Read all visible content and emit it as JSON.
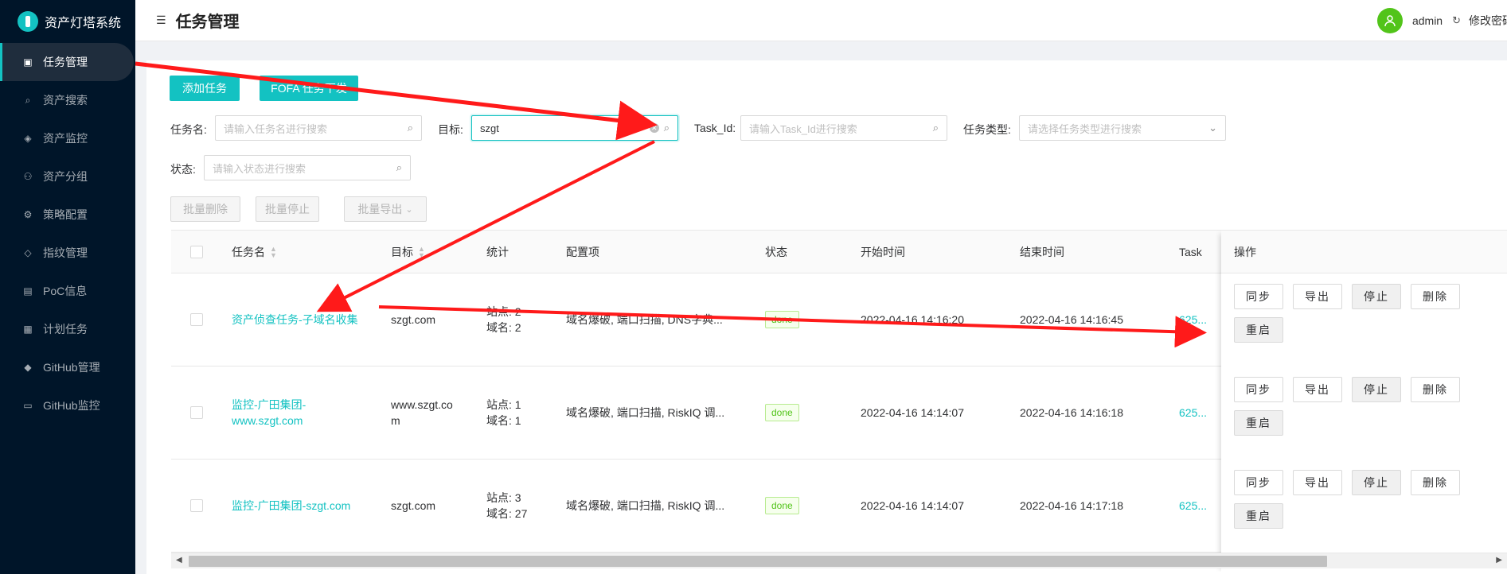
{
  "sidebar": {
    "app_title": "资产灯塔系统",
    "items": [
      {
        "label": "任务管理",
        "icon": "task-icon",
        "active": true
      },
      {
        "label": "资产搜索",
        "icon": "search-icon",
        "active": false
      },
      {
        "label": "资产监控",
        "icon": "shield-icon",
        "active": false
      },
      {
        "label": "资产分组",
        "icon": "group-icon",
        "active": false
      },
      {
        "label": "策略配置",
        "icon": "gear-icon",
        "active": false
      },
      {
        "label": "指纹管理",
        "icon": "tag-icon",
        "active": false
      },
      {
        "label": "PoC信息",
        "icon": "document-icon",
        "active": false
      },
      {
        "label": "计划任务",
        "icon": "schedule-icon",
        "active": false
      },
      {
        "label": "GitHub管理",
        "icon": "github-icon",
        "active": false
      },
      {
        "label": "GitHub监控",
        "icon": "monitor-icon",
        "active": false
      }
    ]
  },
  "header": {
    "page_title": "任务管理",
    "user": "admin",
    "change_password": "修改密码"
  },
  "toolbar": {
    "add_task": "添加任务",
    "fofa_task": "FOFA 任务下发"
  },
  "filters": {
    "task_name_label": "任务名:",
    "task_name_placeholder": "请输入任务名进行搜索",
    "target_label": "目标:",
    "target_value": "szgt",
    "task_id_label": "Task_Id:",
    "task_id_placeholder": "请输入Task_Id进行搜索",
    "task_type_label": "任务类型:",
    "task_type_placeholder": "请选择任务类型进行搜索",
    "status_label": "状态:",
    "status_placeholder": "请输入状态进行搜索"
  },
  "bulk": {
    "delete": "批量删除",
    "stop": "批量停止",
    "export": "批量导出"
  },
  "table": {
    "columns": {
      "name": "任务名",
      "target": "目标",
      "stats": "统计",
      "config": "配置项",
      "status": "状态",
      "start": "开始时间",
      "end": "结束时间",
      "task_id": "Task",
      "ops": "操作"
    },
    "rows": [
      {
        "name_line1": "资产侦查任务-子域名收集",
        "name_line2": "",
        "target_line1": "szgt.com",
        "target_line2": "",
        "stats_line1": "站点: 2",
        "stats_line2": "域名: 2",
        "config": "域名爆破, 端口扫描, DNS字典...",
        "status": "done",
        "start": "2022-04-16 14:16:20",
        "end": "2022-04-16 14:16:45",
        "task_id": "625..."
      },
      {
        "name_line1": "监控-广田集团-",
        "name_line2": "www.szgt.com",
        "target_line1": "www.szgt.co",
        "target_line2": "m",
        "stats_line1": "站点: 1",
        "stats_line2": "域名: 1",
        "config": "域名爆破, 端口扫描, RiskIQ 调...",
        "status": "done",
        "start": "2022-04-16 14:14:07",
        "end": "2022-04-16 14:16:18",
        "task_id": "625..."
      },
      {
        "name_line1": "监控-广田集团-szgt.com",
        "name_line2": "",
        "target_line1": "szgt.com",
        "target_line2": "",
        "stats_line1": "站点: 3",
        "stats_line2": "域名: 27",
        "config": "域名爆破, 端口扫描, RiskIQ 调...",
        "status": "done",
        "start": "2022-04-16 14:14:07",
        "end": "2022-04-16 14:17:18",
        "task_id": "625..."
      }
    ],
    "ops": {
      "sync": "同步",
      "export": "导出",
      "stop": "停止",
      "delete": "删除",
      "restart": "重启"
    }
  },
  "colors": {
    "sidebar_bg": "#001529",
    "accent": "#13c2c2",
    "annotation_arrow": "#ff1a1a",
    "done_tag": "#52c41a"
  }
}
